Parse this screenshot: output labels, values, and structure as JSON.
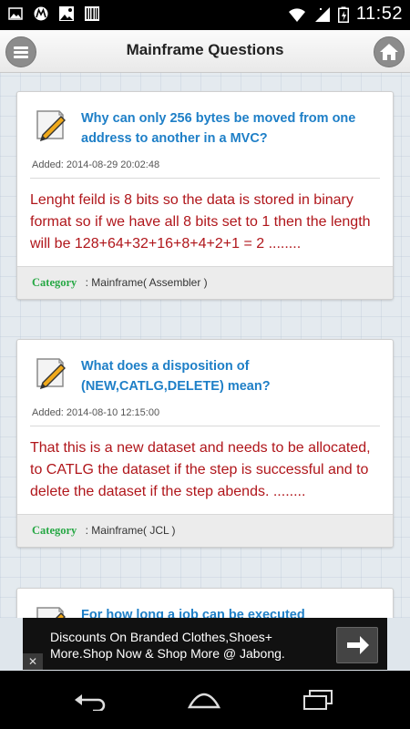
{
  "status_bar": {
    "time": "11:52",
    "icons": [
      "image-icon",
      "motorola-icon",
      "photo-icon",
      "barcode-icon",
      "wifi-icon",
      "signal-icon",
      "battery-icon"
    ]
  },
  "header": {
    "title": "Mainframe Questions",
    "left_icon": "menu-icon",
    "right_icon": "home-icon"
  },
  "cards": [
    {
      "title": "Why can only 256 bytes be moved from one address to another in a MVC?",
      "added": "Added: 2014-08-29 20:02:48",
      "answer": "Lenght feild is 8 bits so the data is stored in binary format so if we have all 8 bits set to 1 then the length will be 128+64+32+16+8+4+2+1 = 2    ........",
      "category_label": "Category",
      "category_value": ": Mainframe( Assembler )"
    },
    {
      "title": "What does a disposition of (NEW,CATLG,DELETE) mean?",
      "added": "Added: 2014-08-10 12:15:00",
      "answer": "That this is a new dataset and needs to be allocated, to CATLG the dataset if the step is successful and to delete the dataset if the step abends.    ........",
      "category_label": "Category",
      "category_value": ": Mainframe( JCL )"
    },
    {
      "title": "For how long a job can be executed continuously"
    }
  ],
  "ad": {
    "text": "Discounts On Branded Clothes,Shoes+ More.Shop Now & Shop More @ Jabong.",
    "close_label": "✕",
    "arrow_icon": "arrow-right-icon"
  },
  "nav_bar": {
    "icons": [
      "back-icon",
      "home-nav-icon",
      "recent-apps-icon"
    ]
  },
  "colors": {
    "title_blue": "#1e7fc7",
    "answer_red": "#b0161b",
    "category_green": "#27a845"
  }
}
